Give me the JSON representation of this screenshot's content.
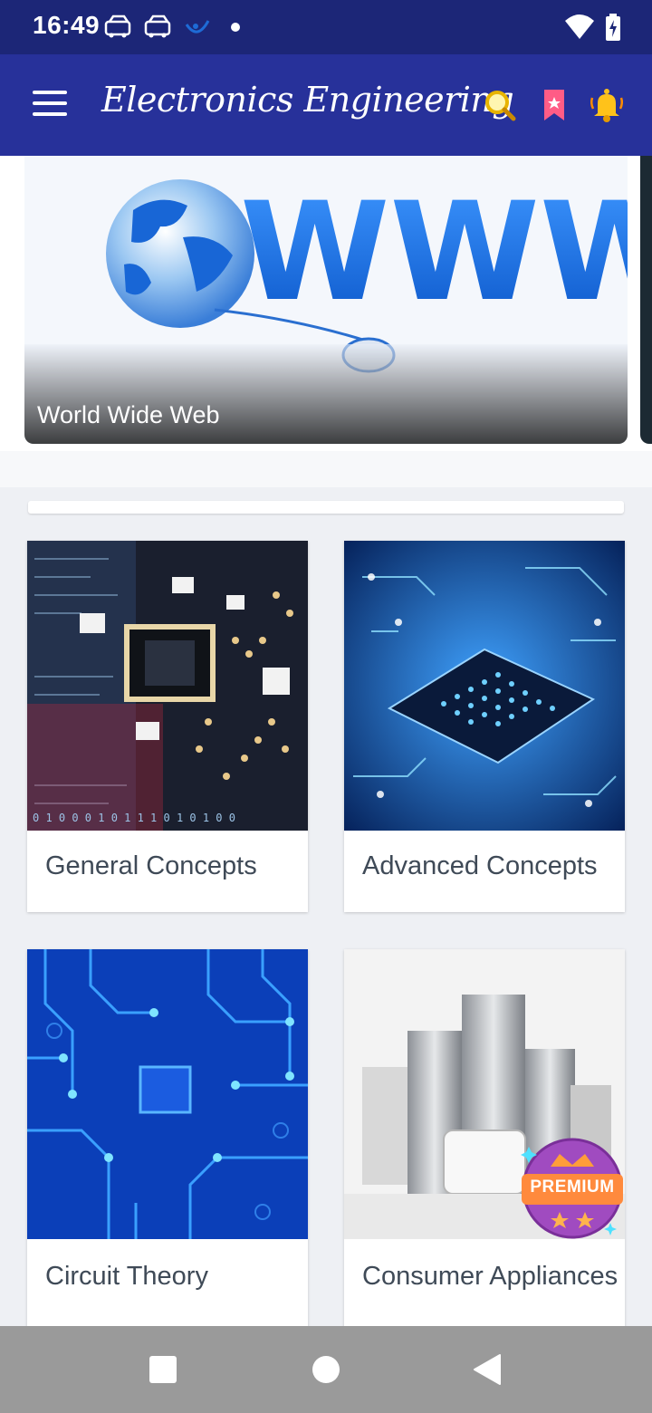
{
  "status_bar": {
    "time": "16:49"
  },
  "app_bar": {
    "title": "Electronics Engineering",
    "icons": [
      "menu-icon",
      "search-icon",
      "bookmark-icon",
      "bell-icon"
    ]
  },
  "banner": {
    "label": "World Wide Web",
    "image_text": "WWW"
  },
  "categories": [
    {
      "label": "General Concepts"
    },
    {
      "label": "Advanced Concepts"
    },
    {
      "label": "Circuit Theory"
    },
    {
      "label": "Consumer Appliances"
    }
  ],
  "premium": {
    "label": "PREMIUM"
  },
  "colors": {
    "status_bar": "#1c2677",
    "app_bar": "#27319a",
    "nav_bar": "#9a9a9a"
  }
}
